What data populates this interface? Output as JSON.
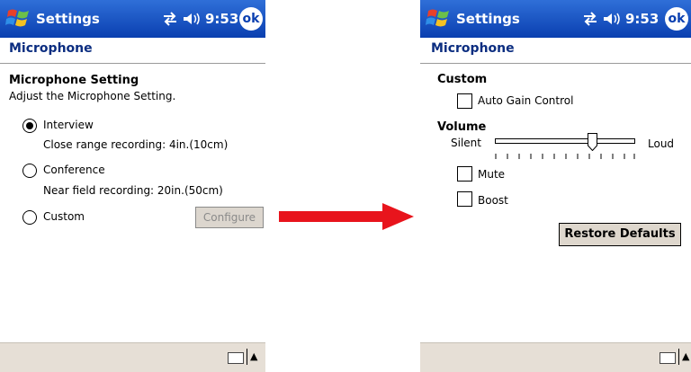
{
  "left": {
    "title": "Settings",
    "clock": "9:53",
    "ok": "ok",
    "page_title": "Microphone",
    "heading": "Microphone Setting",
    "description": "Adjust the Microphone Setting.",
    "options": [
      {
        "label": "Interview",
        "sub": "Close range recording: 4in.(10cm)",
        "selected": true
      },
      {
        "label": "Conference",
        "sub": "Near field recording: 20in.(50cm)",
        "selected": false
      },
      {
        "label": "Custom",
        "sub": "",
        "selected": false
      }
    ],
    "configure_label": "Configure"
  },
  "right": {
    "title": "Settings",
    "clock": "9:53",
    "ok": "ok",
    "page_title": "Microphone",
    "custom_heading": "Custom",
    "agc_label": "Auto Gain Control",
    "agc_checked": false,
    "volume_heading": "Volume",
    "silent_label": "Silent",
    "loud_label": "Loud",
    "volume_level": 0.75,
    "mute_label": "Mute",
    "mute_checked": false,
    "boost_label": "Boost",
    "boost_checked": false,
    "restore_label": "Restore Defaults"
  },
  "colors": {
    "titlebar": "#0a3fb0",
    "page_title": "#0b2d80",
    "arrow": "#e8141c",
    "bottombar": "#e6dfd6"
  },
  "icons": {
    "start": "windows-flag-icon",
    "connectivity": "connectivity-arrows-icon",
    "volume": "speaker-icon",
    "keyboard": "keyboard-icon"
  }
}
